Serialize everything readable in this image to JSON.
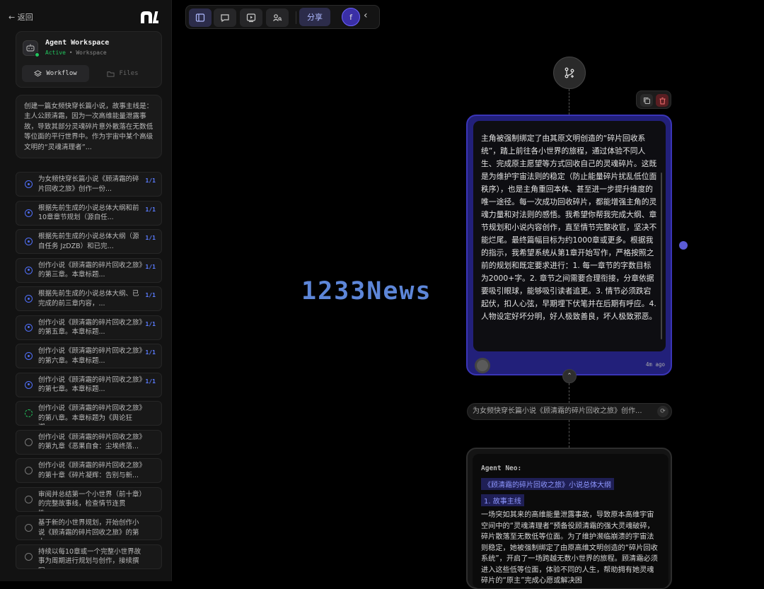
{
  "sidebar": {
    "back_label": "← 返回",
    "workspace": {
      "title": "Agent Workspace",
      "status": "Active",
      "separator": " • ",
      "type": "Workspace"
    },
    "tabs": [
      {
        "label": "Workflow",
        "icon": "layers-icon"
      },
      {
        "label": "Files",
        "icon": "folder-icon"
      }
    ],
    "prompt": "创建一篇女频快穿长篇小说，故事主线是：主人公顾清霜，因为一次高维能量泄露事故，导致其部分灵魂碎片意外散落在无数低等位面的平行世界中。作为宇宙中某个高级文明的“灵魂清理者”...",
    "tasks": [
      {
        "text": "为女频快穿长篇小说《顾清霜的碎片回收之旅》创作一份...",
        "state": "done",
        "badge": "1/1"
      },
      {
        "text": "根据先前生成的小说总体大纲和前10章章节规划（源自任...",
        "state": "done",
        "badge": "1/1"
      },
      {
        "text": "根据先前生成的小说总体大纲（源自任务 JzDZB）和已完...",
        "state": "done",
        "badge": "1/1"
      },
      {
        "text": "创作小说《顾清霜的碎片回收之旅》的第三章。本章标题...",
        "state": "done",
        "badge": "1/1"
      },
      {
        "text": "根据先前生成的小说总体大纲、已完成的前三章内容，...",
        "state": "done",
        "badge": "1/1"
      },
      {
        "text": "创作小说《顾清霜的碎片回收之旅》的第五章。本章标题...",
        "state": "done",
        "badge": "1/1"
      },
      {
        "text": "创作小说《顾清霜的碎片回收之旅》的第六章。本章标题...",
        "state": "done",
        "badge": "1/1"
      },
      {
        "text": "创作小说《顾清霜的碎片回收之旅》的第七章。本章标题...",
        "state": "done",
        "badge": "1/1"
      },
      {
        "text": "创作小说《顾清霜的碎片回收之旅》的第八章。本章标题为《舆论狂潮...",
        "state": "running",
        "badge": ""
      },
      {
        "text": "创作小说《顾清霜的碎片回收之旅》的第九章《恶果自食：尘埃终落...",
        "state": "pending",
        "badge": ""
      },
      {
        "text": "创作小说《顾清霜的碎片回收之旅》的第十章《碎片凝辉：告别与新...",
        "state": "pending",
        "badge": ""
      },
      {
        "text": "审阅并总结第一个小世界（前十章）的完整故事线，检查情节连贯性、...",
        "state": "pending",
        "badge": ""
      },
      {
        "text": "基于新的小世界规划，开始创作小说《顾清霜的碎片回收之旅》的第十...",
        "state": "pending",
        "badge": ""
      },
      {
        "text": "持续以每10章或一个完整小世界故事为周期进行规划与创作，接续撰写...",
        "state": "pending",
        "badge": ""
      }
    ]
  },
  "toolbar": {
    "buttons": [
      "sidebar-toggle-icon",
      "chat-icon",
      "preview-icon",
      "user-search-icon"
    ],
    "share_label": "分享",
    "avatar_letter": "f",
    "collapse_icon": "‹"
  },
  "canvas": {
    "node1": {
      "text": "主角被强制绑定了由其原文明创造的“碎片回收系统”，踏上前往各小世界的旅程，通过体验不同人生、完成原主愿望等方式回收自己的灵魂碎片。这既是为维护宇宙法则的稳定（防止能量碎片扰乱低位面秩序），也是主角重回本体、甚至进一步提升维度的唯一途径。每一次成功回收碎片，都能增强主角的灵魂力量和对法则的感悟。我希望你帮我完成大纲、章节规划和小说内容创作，直至情节完整收官，坚决不能烂尾。最终篇幅目标为约1000章或更多。根据我的指示，我希望系统从第1章开始写作，严格按照之前的规划和既定要求进行：1. 每一章节的字数目标为2000+字。2. 章节之间需要合理衔接，分章依据要吸引眼球，能够吸引读者追更。3. 情节必须跌宕起伏，扣人心弦，早期埋下伏笔并在后期有呼应。4. 人物设定好坏分明，好人极致善良，坏人极致邪恶。",
      "time": "4m ago"
    },
    "watermark": "1233News",
    "task_pill": "为女频快穿长篇小说《顾清霜的碎片回收之旅》创作...",
    "node2": {
      "agent": "Agent Neo:",
      "heading": "《顾清霜的碎片回收之旅》小说总体大纲",
      "subheading": "1. 故事主线",
      "body": "一场突如其来的高维能量泄露事故，导致原本高维宇宙空间中的“灵魂清理者”预备役顾清霜的强大灵魂破碎，碎片散落至无数低等位面。为了维护濒临崩溃的宇宙法则稳定，她被强制绑定了由原高维文明创造的“碎片回收系统”，开启了一场跨越无数小世界的旅程。顾清霜必须进入这些低等位面，体验不同的人生，帮助拥有她灵魂碎片的“原主”完成心愿或解决困"
    }
  }
}
